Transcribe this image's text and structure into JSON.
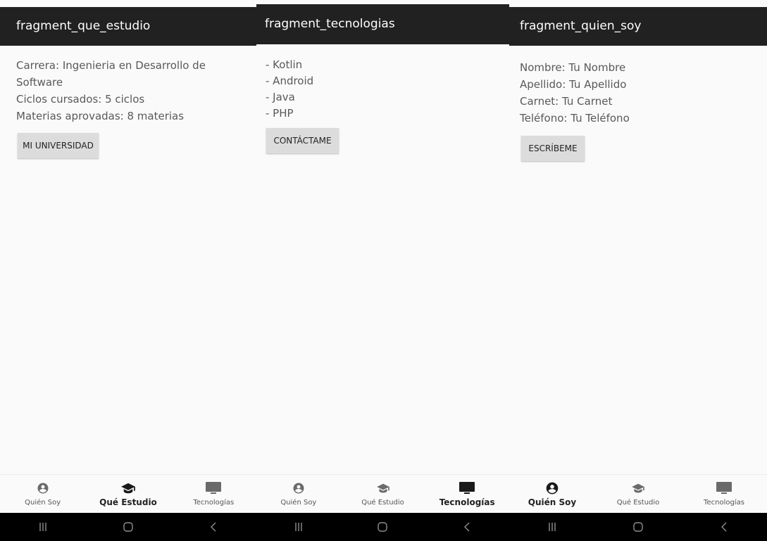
{
  "screens": [
    {
      "title": "fragment_que_estudio",
      "lines": [
        "Carrera: Ingenieria en Desarrollo de Software",
        "Ciclos cursados: 5 ciclos",
        "Materias aprovadas: 8 materias"
      ],
      "button": "MI UNIVERSIDAD",
      "active_tab": "que-estudio"
    },
    {
      "title": "fragment_tecnologias",
      "lines": [
        "- Kotlin",
        "- Android",
        "- Java",
        "- PHP"
      ],
      "button": "CONTÁCTAME",
      "active_tab": "tecnologias"
    },
    {
      "title": "fragment_quien_soy",
      "lines": [
        "Nombre: Tu Nombre",
        "Apellido: Tu Apellido",
        "Carnet: Tu Carnet",
        "Teléfono: Tu Teléfono"
      ],
      "button": "ESCRÍBEME",
      "active_tab": "quien-soy"
    }
  ],
  "bottom_nav": {
    "items": [
      {
        "label": "Quién Soy",
        "icon": "account-circle-icon"
      },
      {
        "label": "Qué Estudio",
        "icon": "graduation-cap-icon"
      },
      {
        "label": "Tecnologías",
        "icon": "monitor-icon"
      }
    ]
  },
  "system_nav": {
    "recents": "recents-icon",
    "home": "home-icon",
    "back": "back-icon"
  }
}
